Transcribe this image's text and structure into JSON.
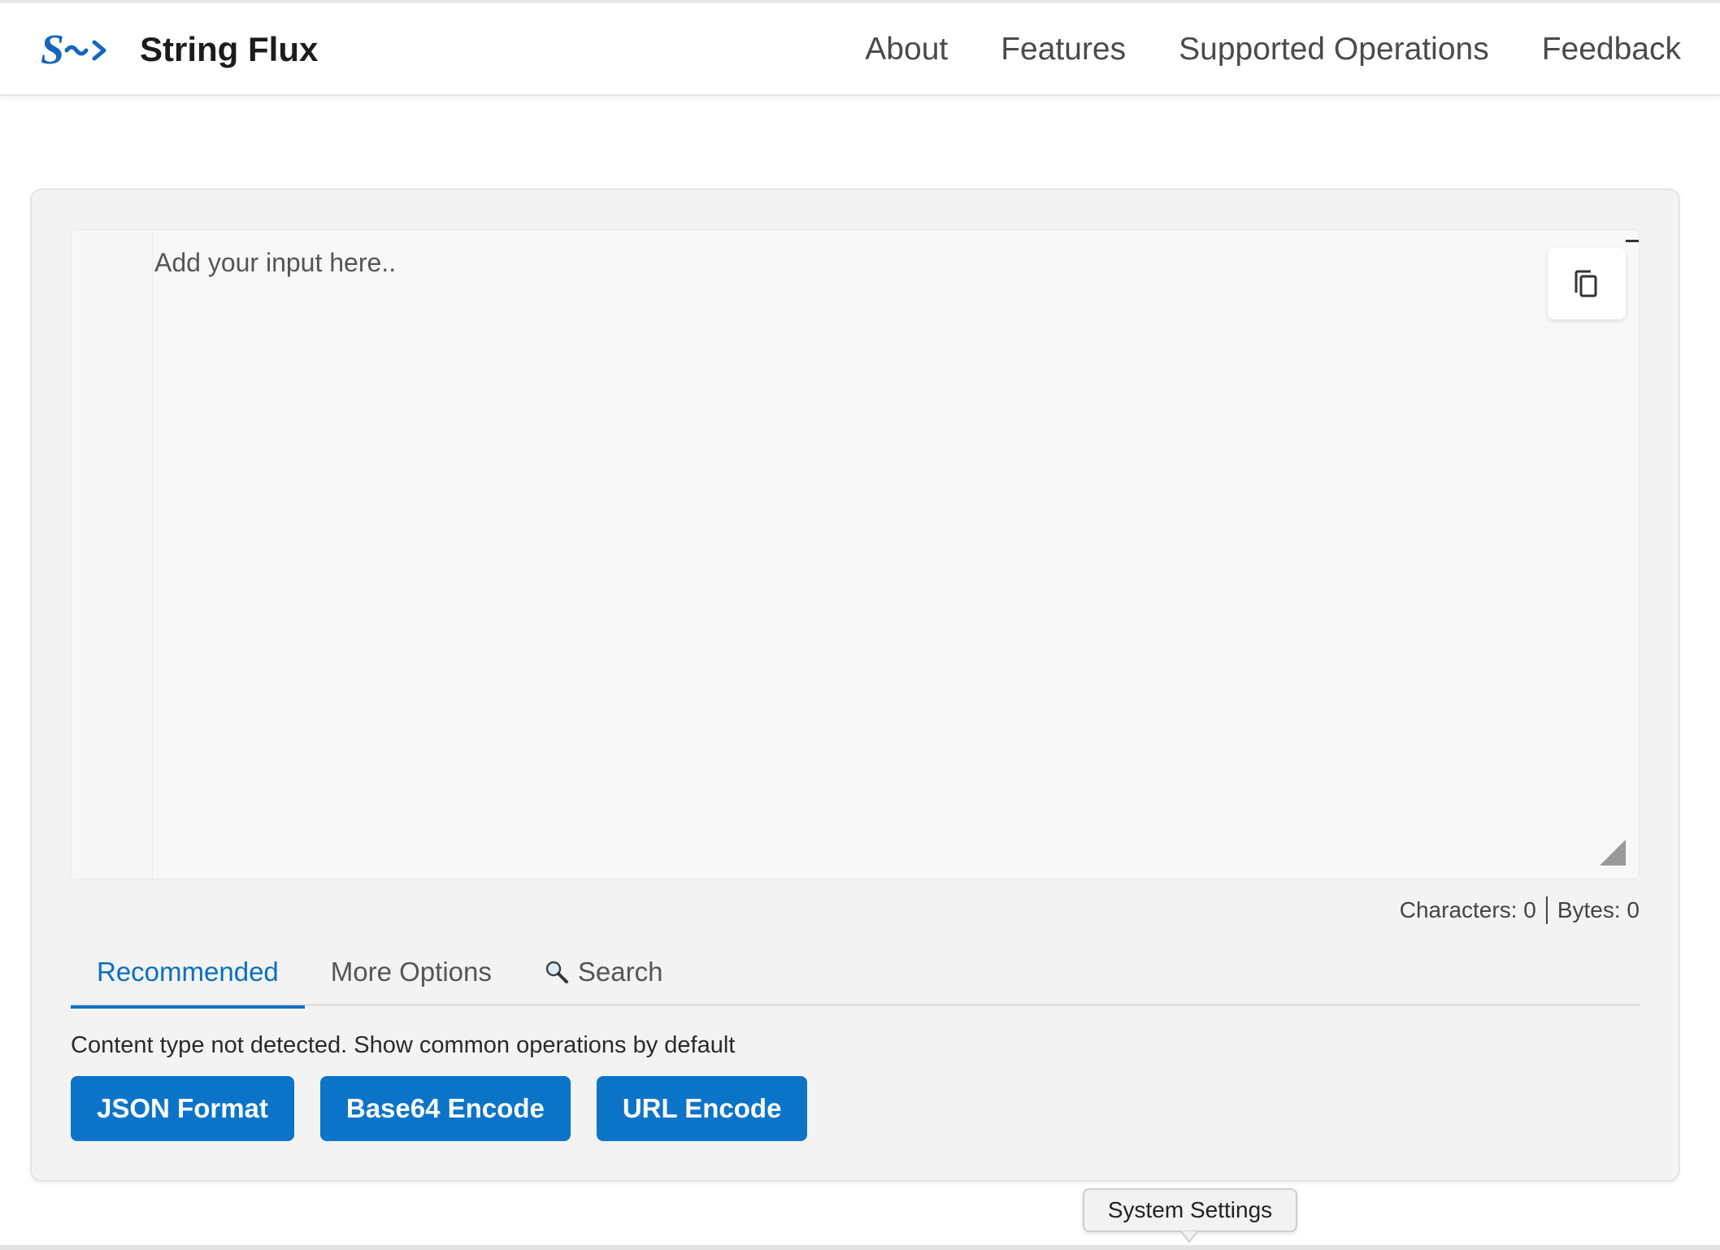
{
  "header": {
    "title": "String Flux",
    "nav": [
      "About",
      "Features",
      "Supported Operations",
      "Feedback"
    ]
  },
  "editor": {
    "placeholder": "Add your input here..",
    "value": ""
  },
  "counter": {
    "characters": "Characters: 0",
    "bytes": "Bytes: 0"
  },
  "tabs": {
    "recommended": "Recommended",
    "more_options": "More Options",
    "search": "Search",
    "active": "Recommended"
  },
  "notice": "Content type not detected. Show common operations by default",
  "operations": [
    "JSON Format",
    "Base64 Encode",
    "URL Encode"
  ],
  "tooltip": "System Settings",
  "colors": {
    "accent": "#0b74c9",
    "tab_active": "#0b6fbf",
    "logo": "#1565c0"
  },
  "icons": {
    "logo": "string-flux-logo-icon",
    "copy": "copy-icon",
    "search": "magnifier-icon",
    "resize": "resize-handle-icon"
  }
}
